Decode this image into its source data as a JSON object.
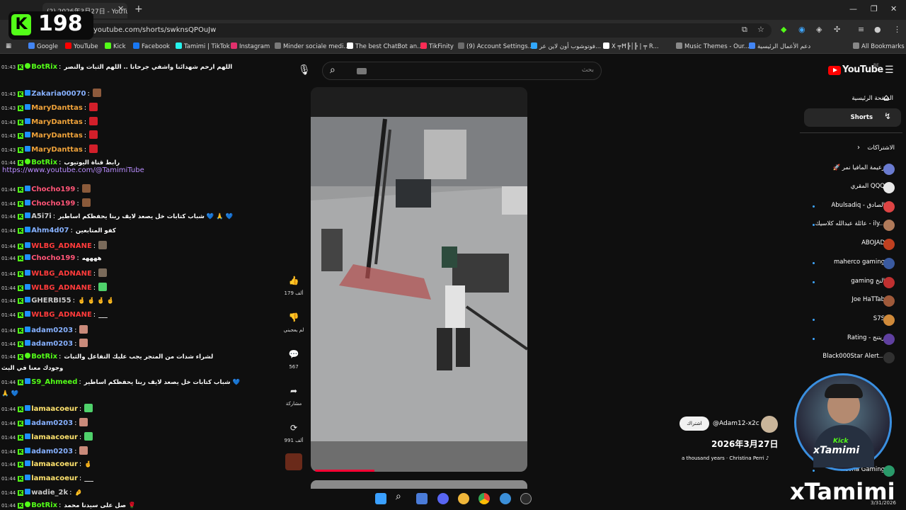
{
  "browser": {
    "tab_title": "(2) 2026年3月27日 - YouTube",
    "url": "youtube.com/shorts/swknsQPOuJw",
    "bookmarks": [
      "Google",
      "YouTube",
      "Kick",
      "Facebook",
      "Tamimi | TikTok",
      "Instagram",
      "Minder sociale medi...",
      "The best ChatBot an...",
      "TikFinity",
      "(9) Account Settings...",
      "فوتوشوب أون لاين عر...",
      "X ╤Ħ╠│╠ | ╤ R...",
      "Music Themes - Our...",
      "دعم الأعمال الرئيسية",
      "All Bookmarks"
    ],
    "bookmark_colors": [
      "#4285f4",
      "#ff0000",
      "#53fc18",
      "#1877f2",
      "#25f4ee",
      "#e1306c",
      "#7a7a7a",
      "#ffffff",
      "#fe2c55",
      "#6c6c6c",
      "#31a8ff",
      "#ffffff",
      "#8a8a8a",
      "#4285f4"
    ]
  },
  "kick": {
    "viewer_count": "198",
    "logo": "K"
  },
  "chat": {
    "messages": [
      {
        "time": "01:43",
        "user": "BotRix",
        "color": "#53fc18",
        "text": "اللهم ارحم شهدائنا واشفي جرحانا .. اللهم الثبات والنصر",
        "bot": true
      },
      {
        "time": "01:43",
        "user": "Zakaria00070",
        "color": "#87b1ff",
        "text": "",
        "emote": "#8d5a3c"
      },
      {
        "time": "01:43",
        "user": "MaryDanttas",
        "color": "#f0a33a",
        "text": "",
        "emote": "#d21f2a"
      },
      {
        "time": "01:43",
        "user": "MaryDanttas",
        "color": "#f0a33a",
        "text": "",
        "emote": "#d21f2a"
      },
      {
        "time": "01:43",
        "user": "MaryDanttas",
        "color": "#f0a33a",
        "text": "",
        "emote": "#d21f2a"
      },
      {
        "time": "01:43",
        "user": "MaryDanttas",
        "color": "#f0a33a",
        "text": "",
        "emote": "#d21f2a"
      },
      {
        "time": "01:44",
        "user": "BotRix",
        "color": "#53fc18",
        "text": "رابط قناة اليوتيوب",
        "bot": true
      },
      {
        "time": "01:44",
        "user": "Chocho199",
        "color": "#ff5577",
        "text": "",
        "emote": "#8a5a3a"
      },
      {
        "time": "01:44",
        "user": "Chocho199",
        "color": "#ff5577",
        "text": "",
        "emote": "#8a5a3a"
      },
      {
        "time": "01:44",
        "user": "A5i7i",
        "color": "#c9c9c9",
        "text": "شباب كتابات خل يصعد لايف ربنا يحفظكم اساطير 💙 🙏 💙"
      },
      {
        "time": "01:44",
        "user": "Ahm4d07",
        "color": "#87b1ff",
        "text": "كفو المتابعين"
      },
      {
        "time": "01:44",
        "user": "WLBG_ADNANE",
        "color": "#ff3b3b",
        "text": "",
        "emote": "#7a6a5a"
      },
      {
        "time": "01:44",
        "user": "Chocho199",
        "color": "#ff5577",
        "text": "ههههه"
      },
      {
        "time": "01:44",
        "user": "WLBG_ADNANE",
        "color": "#ff3b3b",
        "text": "",
        "emote": "#7a6a5a"
      },
      {
        "time": "01:44",
        "user": "WLBG_ADNANE",
        "color": "#ff3b3b",
        "text": "",
        "emote": "#4fd16b"
      },
      {
        "time": "01:44",
        "user": "GHERBI55",
        "color": "#c9c9c9",
        "text": "🤞 🤞 🤞 🤞"
      },
      {
        "time": "01:44",
        "user": "WLBG_ADNANE",
        "color": "#ff3b3b",
        "text": "___"
      },
      {
        "time": "01:44",
        "user": "adam0203",
        "color": "#87b1ff",
        "text": "",
        "emote": "#c98a7a"
      },
      {
        "time": "01:44",
        "user": "adam0203",
        "color": "#87b1ff",
        "text": "",
        "emote": "#c98a7a"
      },
      {
        "time": "01:44",
        "user": "BotRix",
        "color": "#53fc18",
        "text": "لشراء شدات من المتجر يجب عليك التفاعل والثبات",
        "bot": true
      },
      {
        "time": "",
        "user": "",
        "color": "#ffffff",
        "text": "وجودك معنا في البث"
      },
      {
        "time": "01:44",
        "user": "S9_Ahmeed",
        "color": "#53fc18",
        "text": "شباب كتابات خل يصعد لايف ربنا يحفظكم اساطير 💙"
      },
      {
        "time": "",
        "user": "",
        "color": "#ffffff",
        "text": "🙏 💙"
      },
      {
        "time": "01:44",
        "user": "lamaacoeur",
        "color": "#ffe36e",
        "text": "",
        "emote": "#4fd16b"
      },
      {
        "time": "01:44",
        "user": "adam0203",
        "color": "#87b1ff",
        "text": "",
        "emote": "#c98a7a"
      },
      {
        "time": "01:44",
        "user": "lamaacoeur",
        "color": "#ffe36e",
        "text": "",
        "emote": "#4fd16b"
      },
      {
        "time": "01:44",
        "user": "adam0203",
        "color": "#87b1ff",
        "text": "",
        "emote": "#c98a7a"
      },
      {
        "time": "01:44",
        "user": "lamaacoeur",
        "color": "#ffe36e",
        "text": "🤞"
      },
      {
        "time": "01:44",
        "user": "lamaacoeur",
        "color": "#ffe36e",
        "text": "___"
      },
      {
        "time": "01:44",
        "user": "wadie_2k",
        "color": "#c9c9c9",
        "text": "🤌"
      },
      {
        "time": "01:44",
        "user": "BotRix",
        "color": "#53fc18",
        "text": "صل على سيدنا محمد 🌹",
        "bot": true
      }
    ],
    "link": "https://www.youtube.com/@TamimiTube"
  },
  "youtube": {
    "logo": "YouTube",
    "logo_region": "BE",
    "search_placeholder": "بحث",
    "actions": [
      {
        "icon": "like-icon",
        "label": "179 ألف"
      },
      {
        "icon": "dislike-icon",
        "label": "لم يعجبني"
      },
      {
        "icon": "comment-icon",
        "label": "567"
      },
      {
        "icon": "share-icon",
        "label": "مشاركة"
      },
      {
        "icon": "remix-icon",
        "label": "991 ألف"
      }
    ],
    "channel": "@Adam12-x2c",
    "subscribe": "اشتراك",
    "video_title": "2026年3月27日",
    "sound": "a thousand years · Christina Perri ♪",
    "nav": [
      "الصفحة الرئيسية",
      "Shorts"
    ],
    "subscriptions_header": "الاشتراكات",
    "subscriptions": [
      {
        "name": "🚀 زعيمة المافيا نمر",
        "color": "#6a7bd0",
        "dot": false
      },
      {
        "name": "المقري QQQ",
        "color": "#e8e8e8",
        "dot": false
      },
      {
        "name": "Abulsadiq - الصادق",
        "color": "#d44",
        "dot": true
      },
      {
        "name": "عائلة عبدالله كلاسيك - ily...",
        "color": "#b07a5a",
        "dot": true
      },
      {
        "name": "ABOJAD",
        "color": "#c04020",
        "dot": false
      },
      {
        "name": "maherco gaming",
        "color": "#3a5aa0",
        "dot": true
      },
      {
        "name": "gaming النخ",
        "color": "#c03030",
        "dot": true
      },
      {
        "name": "Joe HaTTab",
        "color": "#a05a3a",
        "dot": false
      },
      {
        "name": "S7S",
        "color": "#d08a3a",
        "dot": true
      },
      {
        "name": "Rating - ريتنج",
        "color": "#6040a0",
        "dot": true
      },
      {
        "name": "Black000Star Alert...",
        "color": "#303030",
        "dot": false
      },
      {
        "name": "Revna Gaming",
        "color": "#2a9a6a",
        "dot": true
      }
    ]
  },
  "overlay": {
    "streamer": "xTamimi",
    "avatar_tag": "Kick",
    "avatar_name": "xTamimi"
  },
  "taskbar": {
    "date": "3/31/2026"
  }
}
